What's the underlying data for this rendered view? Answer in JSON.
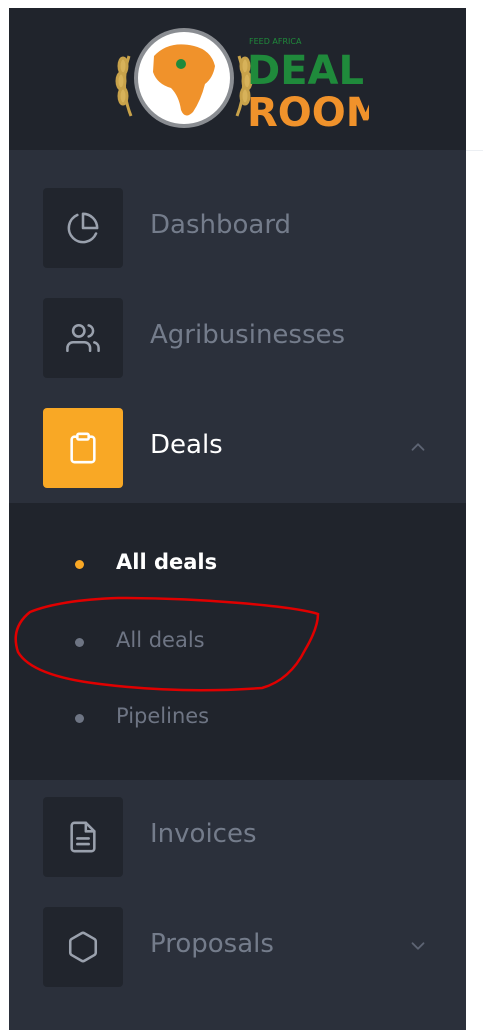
{
  "logo": {
    "tagline": "FEED AFRICA",
    "word1": "DEAL",
    "word2": "ROOM"
  },
  "menu": [
    {
      "label": "Dashboard",
      "icon": "pie-chart-icon",
      "active": false
    },
    {
      "label": "Agribusinesses",
      "icon": "users-icon",
      "active": false
    },
    {
      "label": "Deals",
      "icon": "clipboard-icon",
      "active": true,
      "expanded": true
    },
    {
      "label": "Invoices",
      "icon": "file-text-icon",
      "active": false
    },
    {
      "label": "Proposals",
      "icon": "hexagon-icon",
      "active": false,
      "expandable": true
    }
  ],
  "submenu": [
    {
      "label": "All deals",
      "active": true
    },
    {
      "label": "All deals",
      "active": false
    },
    {
      "label": "Pipelines",
      "active": false
    }
  ],
  "colors": {
    "sidebar": "#2b303b",
    "sidebar_dark": "#20242c",
    "accent": "#f9a825",
    "muted_text": "#747c8b",
    "annotation": "#e00000"
  }
}
